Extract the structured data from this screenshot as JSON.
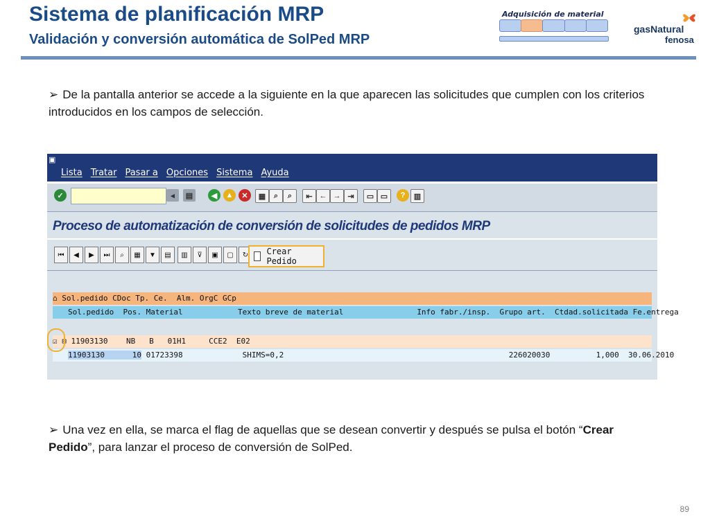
{
  "slide": {
    "title": "Sistema de planificación MRP",
    "subtitle": "Validación y conversión automática de SolPed MRP",
    "stage_label": "Adquisición de material",
    "logo_line1": "gasNatural",
    "logo_line2": "fenosa",
    "bullet1": "De la pantalla anterior se accede a la siguiente en la que aparecen las solicitudes que cumplen con los criterios introducidos en los campos de selección.",
    "bullet2_prefix": "Una vez en ella, se marca el flag de aquellas que se desean convertir y después se pulsa el botón  “",
    "bullet2_bold": "Crear Pedido",
    "bullet2_suffix": "”, para lanzar el proceso de conversión de SolPed.",
    "page_number": "89"
  },
  "sap": {
    "menu": [
      "Lista",
      "Tratar",
      "Pasar a",
      "Opciones",
      "Sistema",
      "Ayuda"
    ],
    "heading": "Proceso de automatización de conversión de solicitudes de pedidos MRP",
    "crear_pedido": "Crear Pedido",
    "header_row1": "Sol.pedido CDoc Tp. Ce.  Alm. OrgC GCp",
    "header_row2": "Sol.pedido  Pos. Material            Texto breve de material                Info fabr./insp.  Grupo art.  Ctdad.solicitada Fe.entrega",
    "data_row1": "11903130    NB   B   01H1     CCE2  E02",
    "data_row2_id": "11903130",
    "data_row2_pos": "10",
    "data_row2_rest": " 01723398             SHIMS=0,2                                                 226020030          1,000  30.06.2010"
  },
  "icons": [
    "check-icon",
    "back-icon",
    "exit-icon",
    "cancel-icon",
    "print-icon",
    "find-icon",
    "first-page-icon",
    "previous-page-icon",
    "next-page-icon",
    "last-page-icon",
    "help-icon",
    "layout-icon"
  ]
}
